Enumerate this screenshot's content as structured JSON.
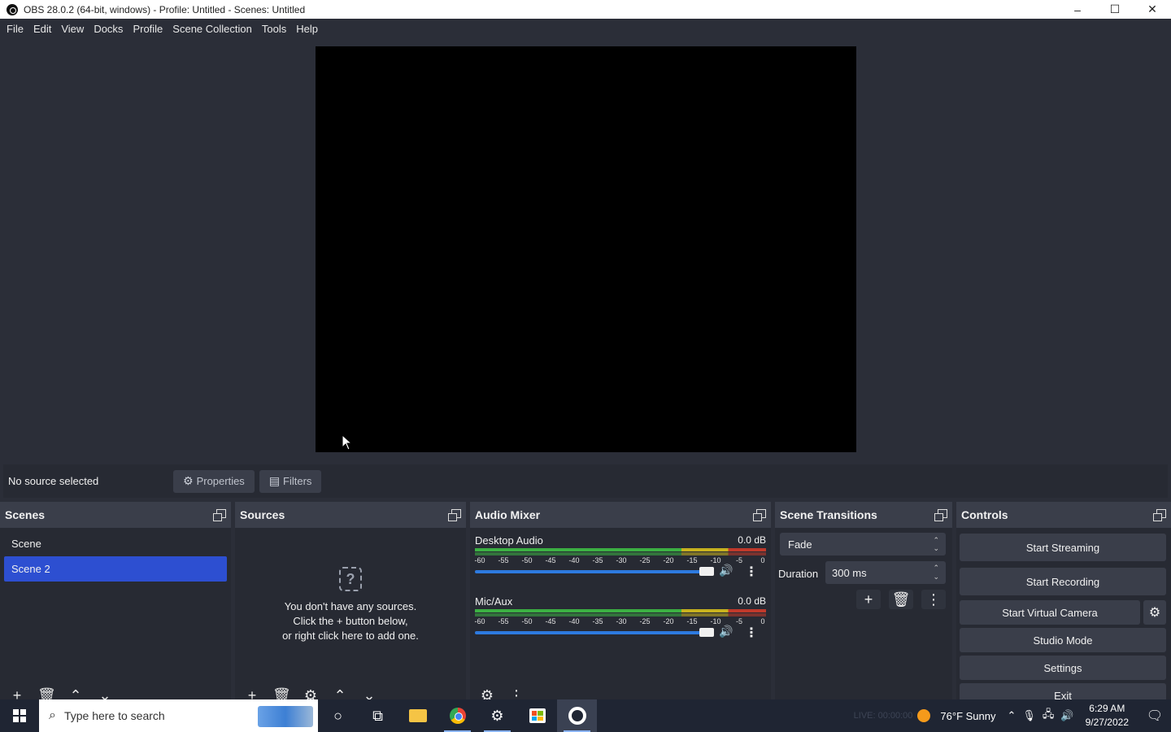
{
  "window": {
    "title": "OBS 28.0.2 (64-bit, windows) - Profile: Untitled - Scenes: Untitled",
    "minimize": "–",
    "maximize": "☐",
    "close": "✕"
  },
  "menu": [
    "File",
    "Edit",
    "View",
    "Docks",
    "Profile",
    "Scene Collection",
    "Tools",
    "Help"
  ],
  "context_bar": {
    "status": "No source selected",
    "properties_label": "Properties",
    "filters_label": "Filters"
  },
  "scenes": {
    "title": "Scenes",
    "items": [
      {
        "label": "Scene",
        "selected": false
      },
      {
        "label": "Scene 2",
        "selected": true
      }
    ]
  },
  "sources": {
    "title": "Sources",
    "empty_line1": "You don't have any sources.",
    "empty_line2": "Click the + button below,",
    "empty_line3": "or right click here to add one."
  },
  "audio_mixer": {
    "title": "Audio Mixer",
    "channels": [
      {
        "name": "Desktop Audio",
        "level": "0.0 dB",
        "volume": 1.0
      },
      {
        "name": "Mic/Aux",
        "level": "0.0 dB",
        "volume": 1.0
      }
    ],
    "ticks": [
      "-60",
      "-55",
      "-50",
      "-45",
      "-40",
      "-35",
      "-30",
      "-25",
      "-20",
      "-15",
      "-10",
      "-5",
      "0"
    ],
    "colors": {
      "green": "#3cb043",
      "yellow": "#c8b21e",
      "red": "#c0392b",
      "slider": "#2d7ae0"
    }
  },
  "scene_transitions": {
    "title": "Scene Transitions",
    "transition": "Fade",
    "duration_label": "Duration",
    "duration_value": "300 ms"
  },
  "controls": {
    "title": "Controls",
    "start_streaming": "Start Streaming",
    "start_recording": "Start Recording",
    "start_virtual_camera": "Start Virtual Camera",
    "studio_mode": "Studio Mode",
    "settings": "Settings",
    "exit": "Exit"
  },
  "taskbar": {
    "search_placeholder": "Type here to search",
    "faint_status": "LIVE: 00:00:00",
    "weather": "76°F  Sunny",
    "time": "6:29 AM",
    "date": "9/27/2022"
  },
  "colors": {
    "window_bg": "#2b2e38",
    "dock_bg": "#272a33",
    "header_bg": "#3a3e4a",
    "selected": "#2d4fd1"
  }
}
